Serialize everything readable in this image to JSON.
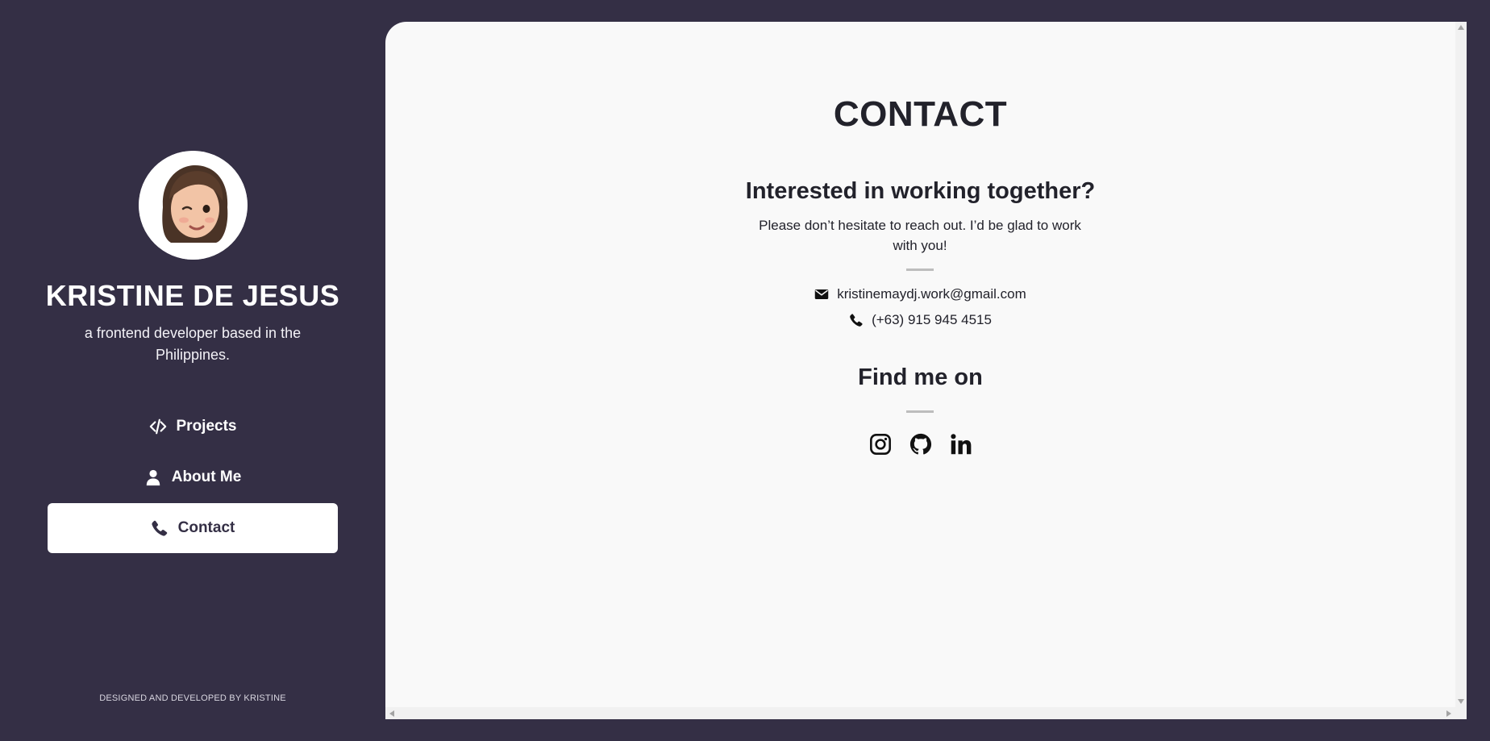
{
  "colors": {
    "background": "#342f45",
    "panel": "#f9f9f9",
    "text_dark": "#22222b",
    "divider": "#bdbdbd"
  },
  "profile": {
    "avatar_icon": "memoji-avatar",
    "name": "KRISTINE DE JESUS",
    "tagline": "a frontend developer based in the Philippines."
  },
  "nav": {
    "items": [
      {
        "label": "Projects",
        "icon": "code-icon",
        "active": false
      },
      {
        "label": "About Me",
        "icon": "user-icon",
        "active": false
      },
      {
        "label": "Contact",
        "icon": "phone-icon",
        "active": true
      }
    ]
  },
  "footer": {
    "credit": "DESIGNED AND DEVELOPED BY KRISTINE"
  },
  "contact": {
    "title": "CONTACT",
    "subtitle": "Interested in working together?",
    "intro": "Please don’t hesitate to reach out. I’d be glad to work with you!",
    "email": "kristinemaydj.work@gmail.com",
    "phone": "(+63) 915 945 4515",
    "find_title": "Find me on",
    "socials": [
      "instagram-icon",
      "github-icon",
      "linkedin-icon"
    ]
  }
}
